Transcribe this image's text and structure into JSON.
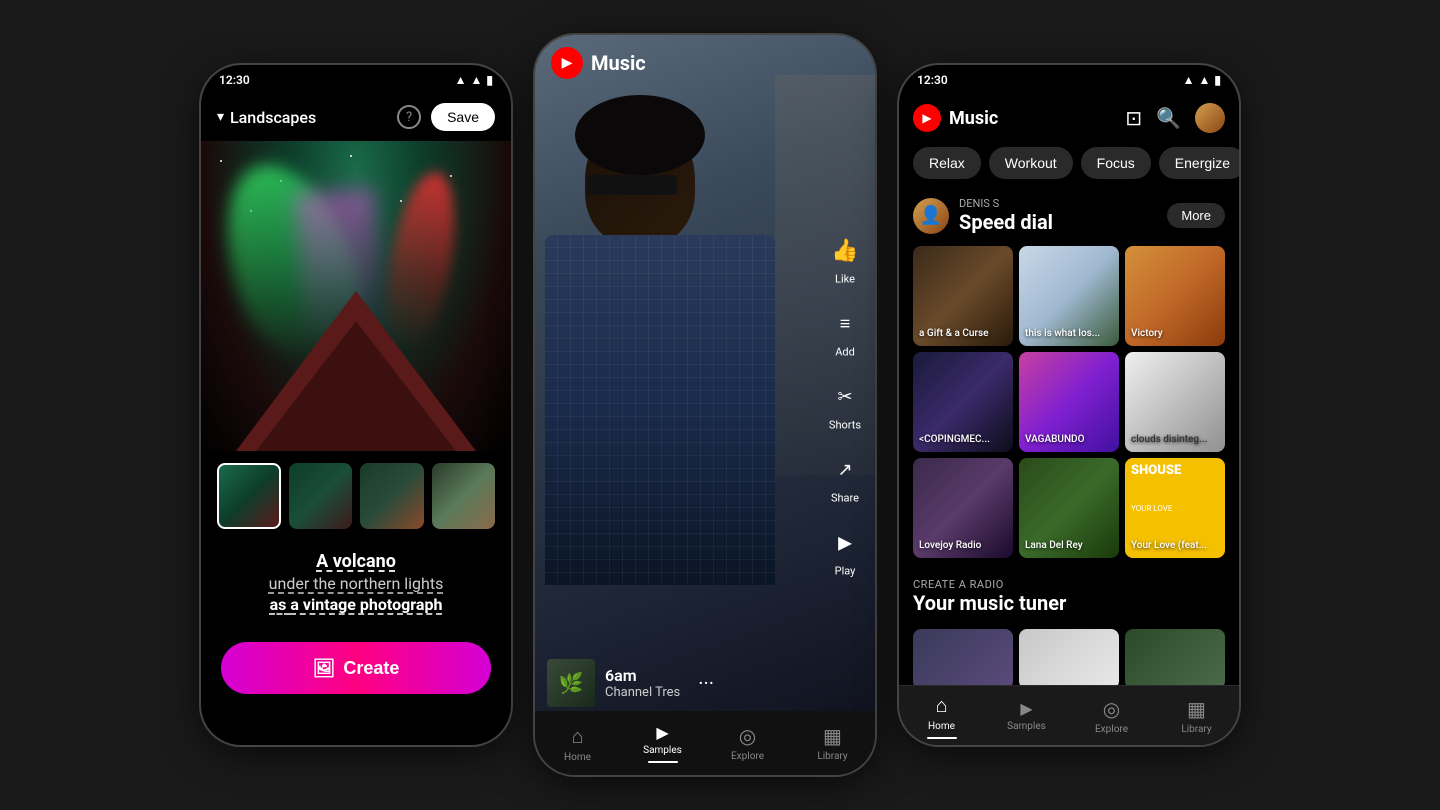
{
  "phone1": {
    "status": {
      "time": "12:30"
    },
    "header": {
      "title": "Landscapes",
      "help_label": "?",
      "save_label": "Save"
    },
    "prompt": {
      "line1": "A volcano",
      "line2": "under the northern lights",
      "line3_prefix": "as ",
      "line3_bold": "a vintage photograph"
    },
    "create_label": "Create",
    "thumbs": [
      "aurora1",
      "aurora2",
      "mountain1",
      "mountain2"
    ]
  },
  "phone2": {
    "status": {
      "time": ""
    },
    "header": {
      "app_name": "Music"
    },
    "actions": [
      {
        "icon": "👍",
        "label": "Like"
      },
      {
        "icon": "≡+",
        "label": "Add"
      },
      {
        "icon": "✂",
        "label": "Shorts"
      },
      {
        "icon": "↗",
        "label": "Share"
      },
      {
        "icon": "▶",
        "label": "Play"
      }
    ],
    "song": {
      "time": "6am",
      "artist": "Channel Tres"
    },
    "nav": [
      {
        "icon": "⌂",
        "label": "Home",
        "active": false
      },
      {
        "icon": "▶",
        "label": "Samples",
        "active": true
      },
      {
        "icon": "◎",
        "label": "Explore",
        "active": false
      },
      {
        "icon": "▦",
        "label": "Library",
        "active": false
      }
    ]
  },
  "phone3": {
    "status": {
      "time": "12:30"
    },
    "header": {
      "app_name": "Music"
    },
    "mood_tabs": [
      {
        "label": "Relax",
        "active": false
      },
      {
        "label": "Workout",
        "active": false
      },
      {
        "label": "Focus",
        "active": false
      },
      {
        "label": "Energize",
        "active": false
      }
    ],
    "speed_dial": {
      "user": "DENIS S",
      "title": "Speed dial",
      "more_label": "More",
      "items": [
        {
          "label": "a Gift & a Curse",
          "style": "gi-1"
        },
        {
          "label": "this is what los...",
          "style": "gi-2"
        },
        {
          "label": "Victory",
          "style": "gi-3"
        },
        {
          "label": "<COPINGMEC...",
          "style": "gi-4"
        },
        {
          "label": "VAGABUNDO",
          "style": "gi-5"
        },
        {
          "label": "clouds disinteg...",
          "style": "gi-6"
        },
        {
          "label": "Lovejoy Radio",
          "style": "gi-7"
        },
        {
          "label": "Lana Del Rey",
          "style": "gi-8"
        },
        {
          "label": "Your Love (feat...",
          "style": "gi-9 shouse-bg"
        }
      ]
    },
    "create_radio": {
      "label": "CREATE A RADIO",
      "title": "Your music tuner"
    },
    "nav": [
      {
        "icon": "⌂",
        "label": "Home",
        "active": true
      },
      {
        "icon": "▶",
        "label": "Samples",
        "active": false
      },
      {
        "icon": "◎",
        "label": "Explore",
        "active": false
      },
      {
        "icon": "▦",
        "label": "Library",
        "active": false
      }
    ]
  }
}
